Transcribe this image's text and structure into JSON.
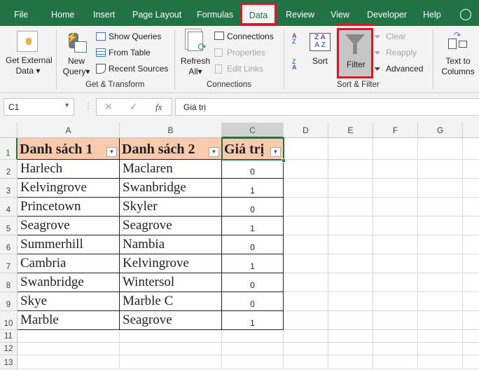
{
  "tabs": [
    "File",
    "Home",
    "Insert",
    "Page Layout",
    "Formulas",
    "Data",
    "Review",
    "View",
    "Developer",
    "Help"
  ],
  "active_tab": "Data",
  "ribbon": {
    "get_external": [
      "Get External",
      "Data"
    ],
    "new_query": [
      "New",
      "Query"
    ],
    "show_queries": "Show Queries",
    "from_table": "From Table",
    "recent_sources": "Recent Sources",
    "group_get_transform": "Get & Transform",
    "refresh_all": [
      "Refresh",
      "All"
    ],
    "connections": "Connections",
    "properties": "Properties",
    "edit_links": "Edit Links",
    "group_connections": "Connections",
    "sort": "Sort",
    "filter": "Filter",
    "clear": "Clear",
    "reapply": "Reapply",
    "advanced": "Advanced",
    "group_sort_filter": "Sort & Filter",
    "text_to_columns": [
      "Text to",
      "Columns"
    ]
  },
  "formula_bar": {
    "name_box": "C1",
    "fx": "fx",
    "formula": "Giá trị"
  },
  "columns": [
    "A",
    "B",
    "C",
    "D",
    "E",
    "F",
    "G"
  ],
  "rows": [
    "1",
    "2",
    "3",
    "4",
    "5",
    "6",
    "7",
    "8",
    "9",
    "10",
    "11",
    "12",
    "13"
  ],
  "headers": [
    "Danh sách 1",
    "Danh sách 2",
    "Giá trị"
  ],
  "data": [
    [
      "Harlech",
      "Maclaren",
      "0"
    ],
    [
      "Kelvingrove",
      "Swanbridge",
      "1"
    ],
    [
      "Princetown",
      "Skyler",
      "0"
    ],
    [
      "Seagrove",
      "Seagrove",
      "1"
    ],
    [
      "Summerhill",
      "Nambia",
      "0"
    ],
    [
      "Cambria",
      "Kelvingrove",
      "1"
    ],
    [
      "Swanbridge",
      "Wintersol",
      "0"
    ],
    [
      "Skye",
      "Marble C",
      "0"
    ],
    [
      "Marble",
      "Seagrove",
      "1"
    ]
  ],
  "colors": {
    "excel_green": "#217346",
    "highlight_red": "#e81123",
    "header_fill": "#f8cbad"
  }
}
